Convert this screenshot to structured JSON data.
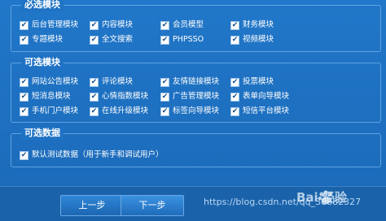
{
  "groups": [
    {
      "title": "必选模块",
      "items": [
        "后台管理模块",
        "内容模块",
        "会员模型",
        "财务模块",
        "专题模块",
        "全文搜索",
        "PHPSSO",
        "视频模块"
      ]
    },
    {
      "title": "可选模块",
      "items": [
        "网站公告模块",
        "评论模块",
        "友情链接模块",
        "投票模块",
        "短消息模块",
        "心情指数模块",
        "广告管理模块",
        "表单向导模块",
        "手机门户模块",
        "在线升级模块",
        "标签向导模块",
        "短信平台模块"
      ]
    },
    {
      "title": "可选数据",
      "items": [
        "默认测试数据（用于新手和调试用户）"
      ]
    }
  ],
  "buttons": {
    "prev": "上一步",
    "next": "下一步"
  },
  "watermark": {
    "url": "https://blog.csdn.net/qq_38882327",
    "brand": "Bai 经验"
  },
  "colors": {
    "background": "#1e6fc0",
    "border": "#5fa3e2"
  }
}
